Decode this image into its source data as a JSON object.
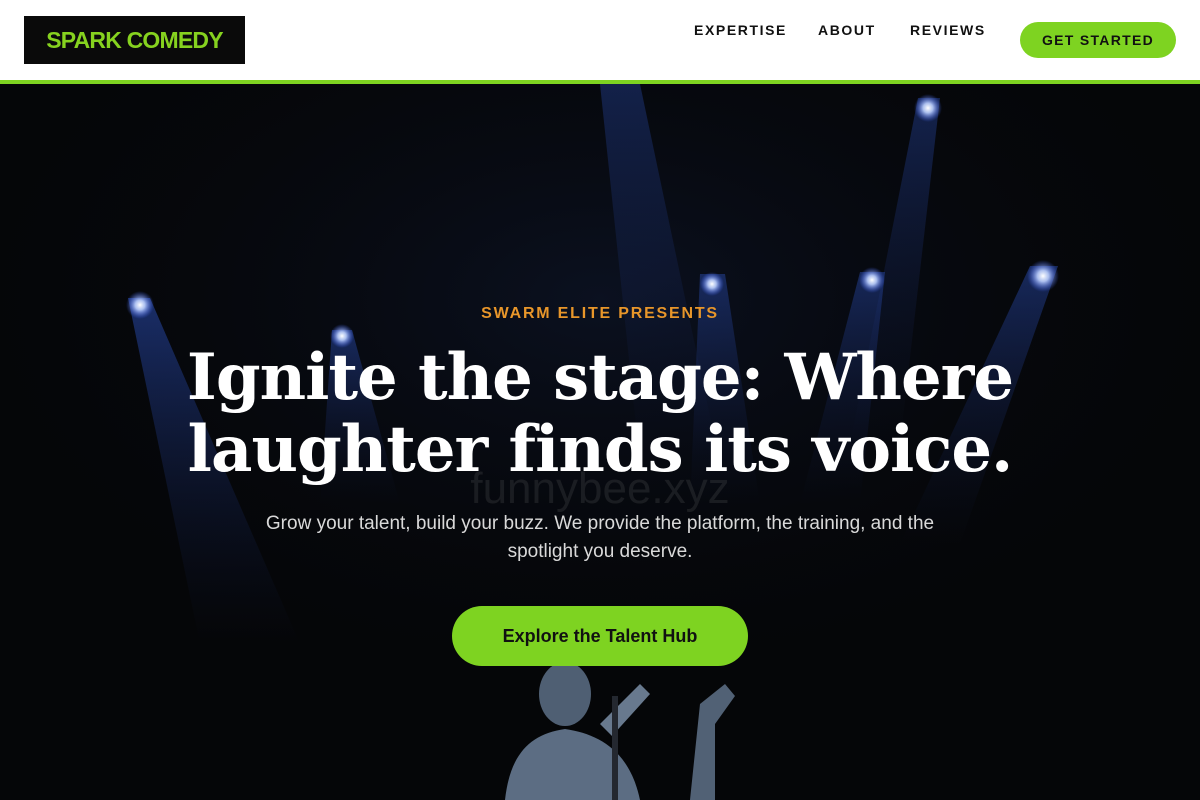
{
  "brand": {
    "name": "SPARK COMEDY",
    "color": "#7ed321"
  },
  "nav": {
    "items": [
      {
        "label": "EXPERTISE"
      },
      {
        "label": "ABOUT"
      },
      {
        "label": "REVIEWS"
      }
    ],
    "cta_label": "GET STARTED"
  },
  "hero": {
    "eyebrow": "SWARM ELITE PRESENTS",
    "headline_line1": "Ignite the stage: Where",
    "headline_line2": "laughter finds its voice.",
    "subtext_line1": "Grow your talent, build your buzz. We provide the platform, the training, and the",
    "subtext_line2": "spotlight you deserve.",
    "cta_label": "Explore the Talent Hub",
    "watermark": "funnybee.xyz",
    "background_image": "concert-stage-spotlights-with-performer"
  },
  "colors": {
    "accent_green": "#7ed321",
    "eyebrow_orange": "#e8962a",
    "header_bg": "#ffffff",
    "hero_bg": "#050608"
  }
}
